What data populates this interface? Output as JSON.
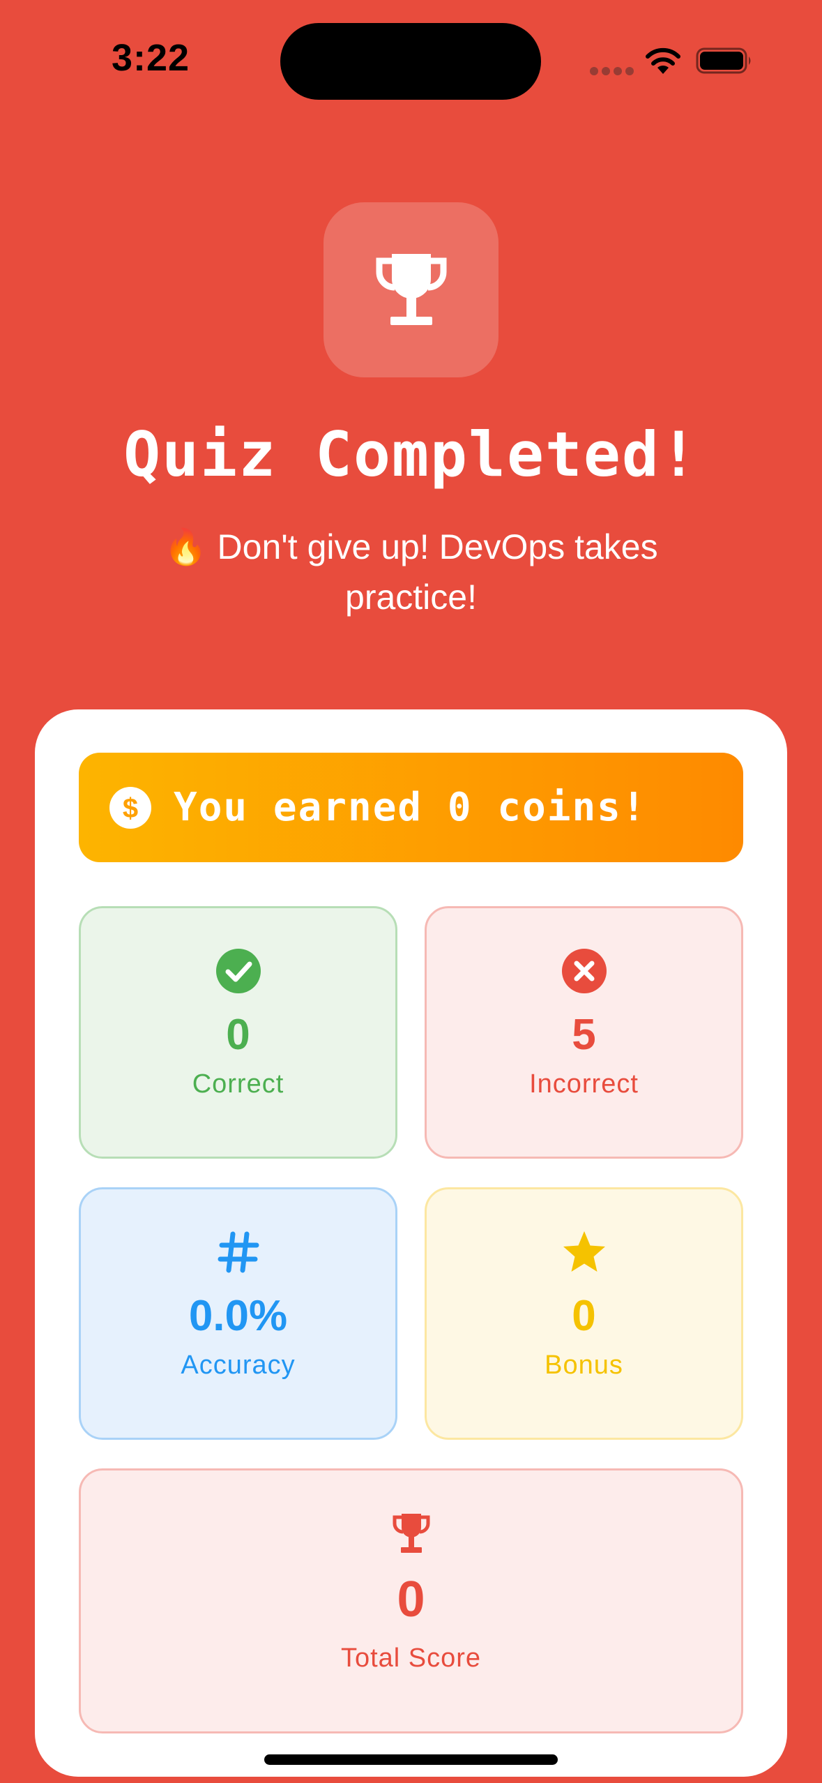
{
  "status_bar": {
    "time": "3:22"
  },
  "header": {
    "trophy_icon": "trophy-icon",
    "title": "Quiz Completed!",
    "subtitle": "🔥 Don't give up! DevOps takes practice!"
  },
  "coins": {
    "icon": "dollar-coin-icon",
    "text": "You earned 0 coins!"
  },
  "stats": {
    "correct": {
      "icon": "check-circle-icon",
      "value": "0",
      "label": "Correct",
      "color": "#4CAF50"
    },
    "incorrect": {
      "icon": "x-circle-icon",
      "value": "5",
      "label": "Incorrect",
      "color": "#E84C3D"
    },
    "accuracy": {
      "icon": "hash-icon",
      "value": "0.0%",
      "label": "Accuracy",
      "color": "#2196F3"
    },
    "bonus": {
      "icon": "star-icon",
      "value": "0",
      "label": "Bonus",
      "color": "#F5C200"
    },
    "total": {
      "icon": "trophy-icon",
      "value": "0",
      "label": "Total Score",
      "color": "#E84C3D"
    }
  },
  "colors": {
    "background": "#E84C3D",
    "card": "#FFFFFF",
    "banner_start": "#FDB400",
    "banner_end": "#FE8A00"
  }
}
